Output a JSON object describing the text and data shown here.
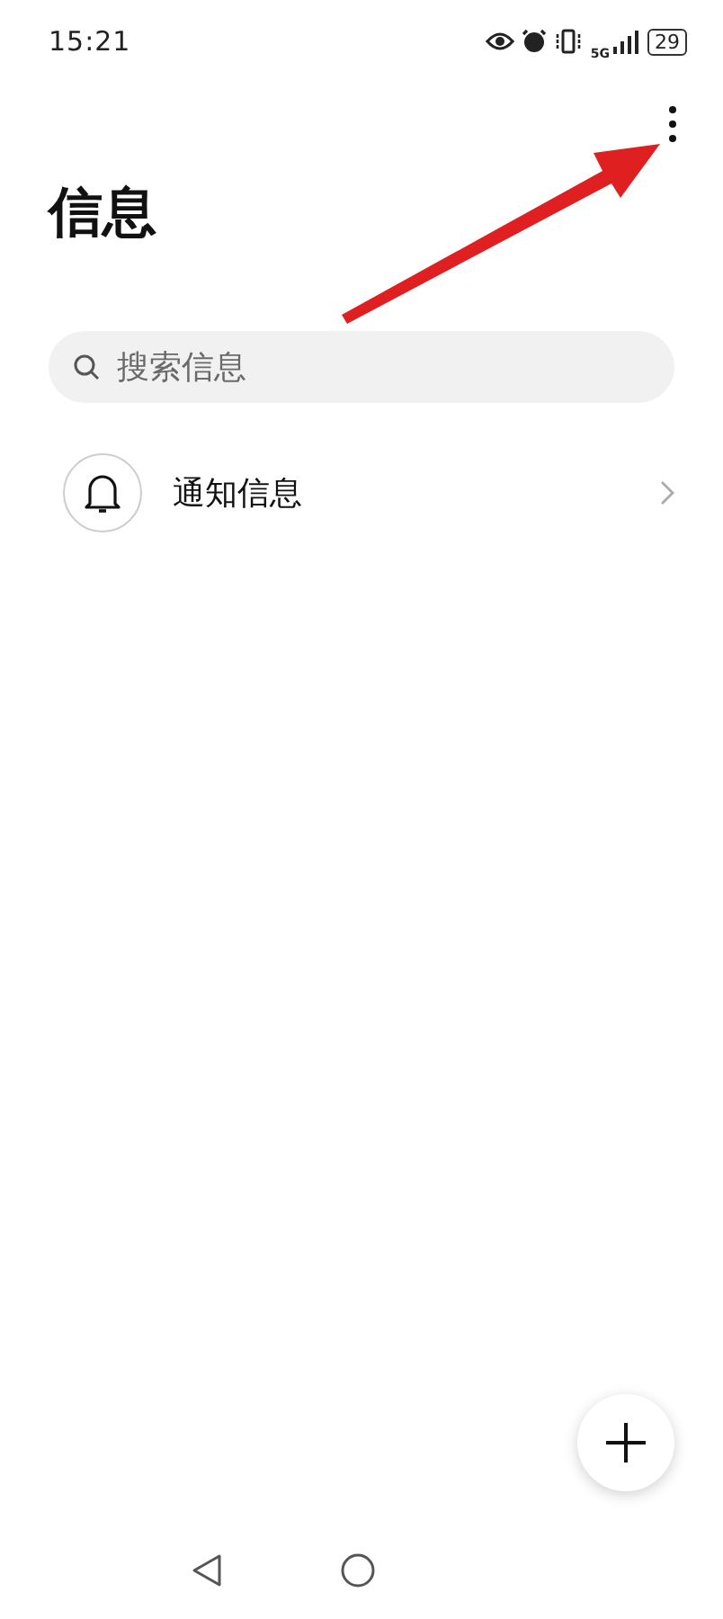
{
  "status_bar": {
    "time": "15:21",
    "network": "5G",
    "battery": "29"
  },
  "title": "信息",
  "search": {
    "placeholder": "搜索信息"
  },
  "items": [
    {
      "label": "通知信息"
    }
  ]
}
